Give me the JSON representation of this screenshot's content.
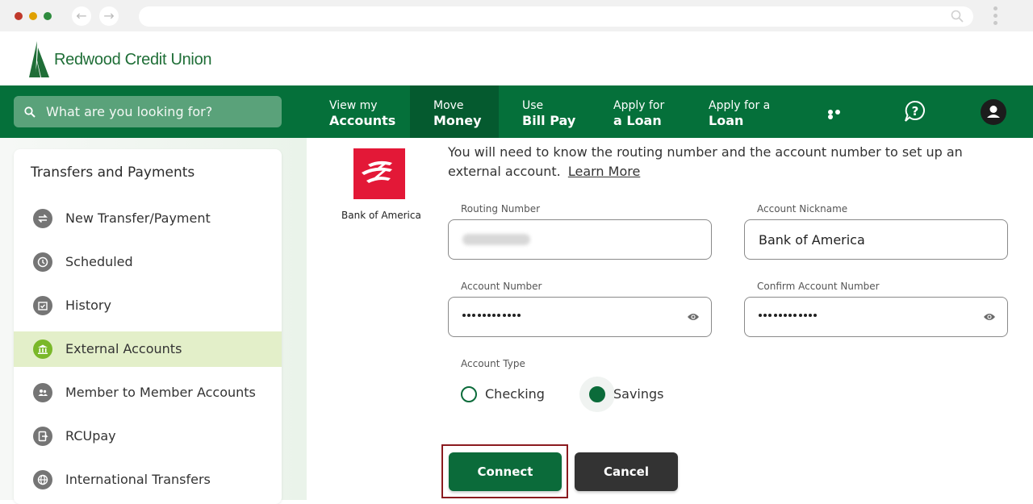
{
  "brand": {
    "name": "Redwood Credit Union",
    "color": "#05703a"
  },
  "search": {
    "placeholder": "What are you looking for?"
  },
  "nav": {
    "items": [
      {
        "line1": "View my",
        "line2": "Accounts"
      },
      {
        "line1": "Move",
        "line2": "Money",
        "active": true
      },
      {
        "line1": "Use",
        "line2": "Bill Pay"
      },
      {
        "line1": "Apply for",
        "line2": "a Loan"
      },
      {
        "line1": "Apply for a",
        "line2": "Loan"
      }
    ],
    "more_icon": "more-icon",
    "help_icon": "chat-help-icon",
    "user_icon": "user-icon"
  },
  "sidebar": {
    "title": "Transfers and Payments",
    "items": [
      {
        "label": "New Transfer/Payment",
        "icon": "transfer-icon"
      },
      {
        "label": "Scheduled",
        "icon": "clock-icon"
      },
      {
        "label": "History",
        "icon": "calendar-check-icon"
      },
      {
        "label": "External Accounts",
        "icon": "bank-icon",
        "active": true
      },
      {
        "label": "Member to Member Accounts",
        "icon": "people-icon"
      },
      {
        "label": "RCUpay",
        "icon": "rcupay-icon"
      },
      {
        "label": "International Transfers",
        "icon": "globe-icon"
      }
    ]
  },
  "bank": {
    "name": "Bank of America",
    "logo_color": "#e31837"
  },
  "form": {
    "intro": "You will need to know the routing number and the account number to set up an external account.",
    "learn_more": "Learn More",
    "routing": {
      "label": "Routing Number"
    },
    "nickname": {
      "label": "Account Nickname",
      "value": "Bank of America"
    },
    "account_number": {
      "label": "Account Number",
      "masked_length": 12
    },
    "confirm_account_number": {
      "label": "Confirm Account Number",
      "masked_length": 12
    },
    "account_type": {
      "label": "Account Type",
      "options": [
        "Checking",
        "Savings"
      ],
      "selected": "Savings"
    },
    "connect_label": "Connect",
    "cancel_label": "Cancel"
  }
}
